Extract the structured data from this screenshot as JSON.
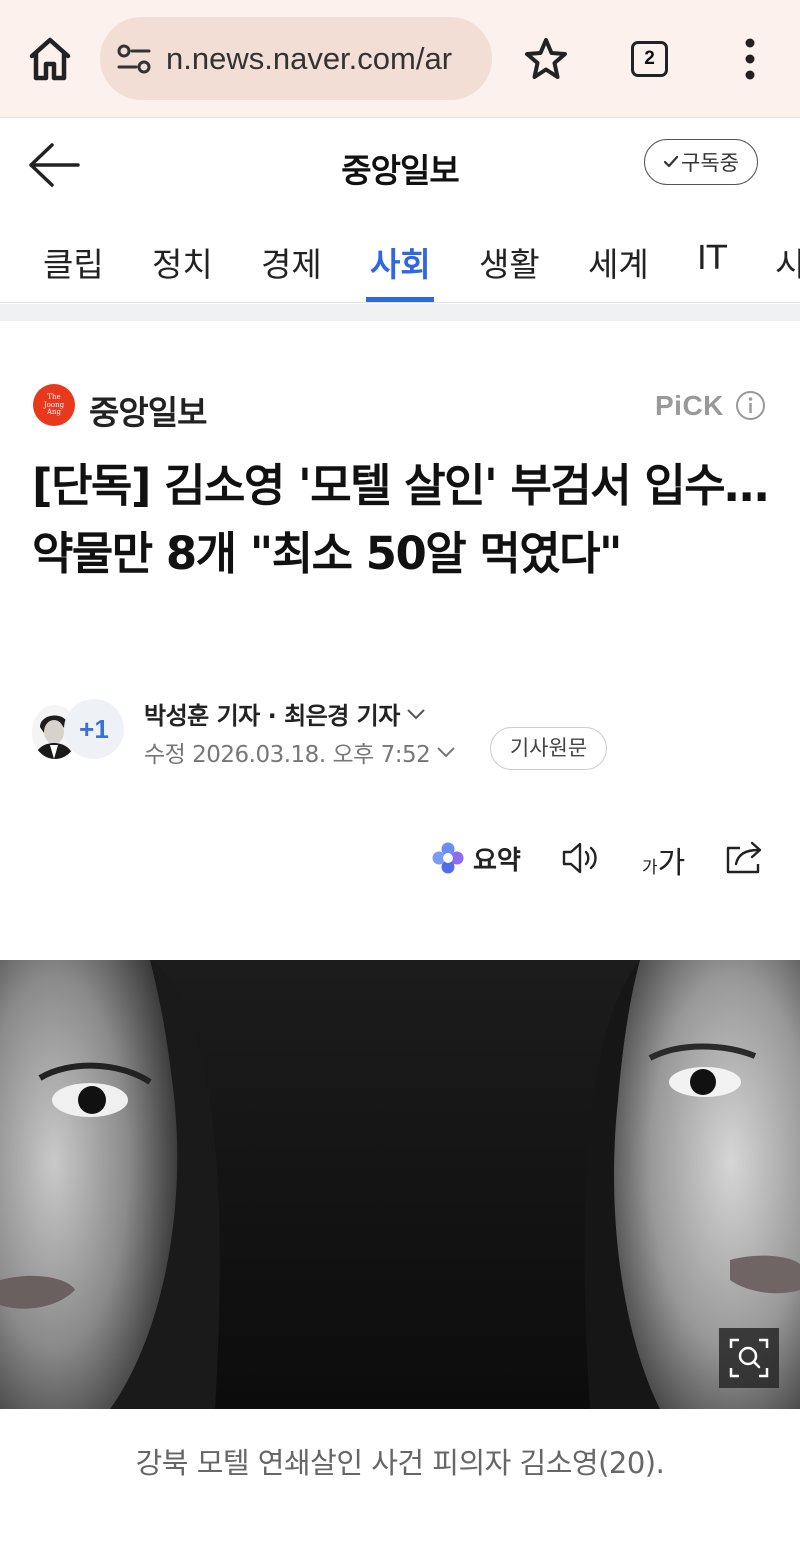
{
  "browser": {
    "url": "n.news.naver.com/ar",
    "tab_count": "2",
    "icons": [
      "home-icon",
      "site-settings-icon",
      "bookmark-star-icon",
      "tab-switcher-icon",
      "overflow-menu-icon"
    ]
  },
  "header": {
    "press_title": "중앙일보",
    "subscribe_label": "구독중"
  },
  "categories": {
    "tabs": [
      "클립",
      "정치",
      "경제",
      "사회",
      "생활",
      "세계",
      "IT",
      "시"
    ],
    "active": "사회"
  },
  "article": {
    "press_name": "중앙일보",
    "press_logo_text": "The JoongAng",
    "pick_label": "PiCK",
    "headline": "[단독] 김소영 '모텔 살인' 부검서 입수…약물만 8개 \"최소 50알 먹였다\"",
    "reporter_extra": "+1",
    "reporters": "박성훈 기자 · 최은경 기자",
    "modified": "수정 2026.03.18. 오후 7:52",
    "original_link_label": "기사원문",
    "photo_caption": "강북 모텔 연쇄살인 사건 피의자 김소영(20)."
  },
  "toolbar": {
    "summary_label": "요약",
    "font_small": "가",
    "font_big": "가"
  },
  "colors": {
    "accent_blue": "#2f67e3",
    "press_red": "#e8391d",
    "chrome_bg": "#fcf1ec"
  }
}
